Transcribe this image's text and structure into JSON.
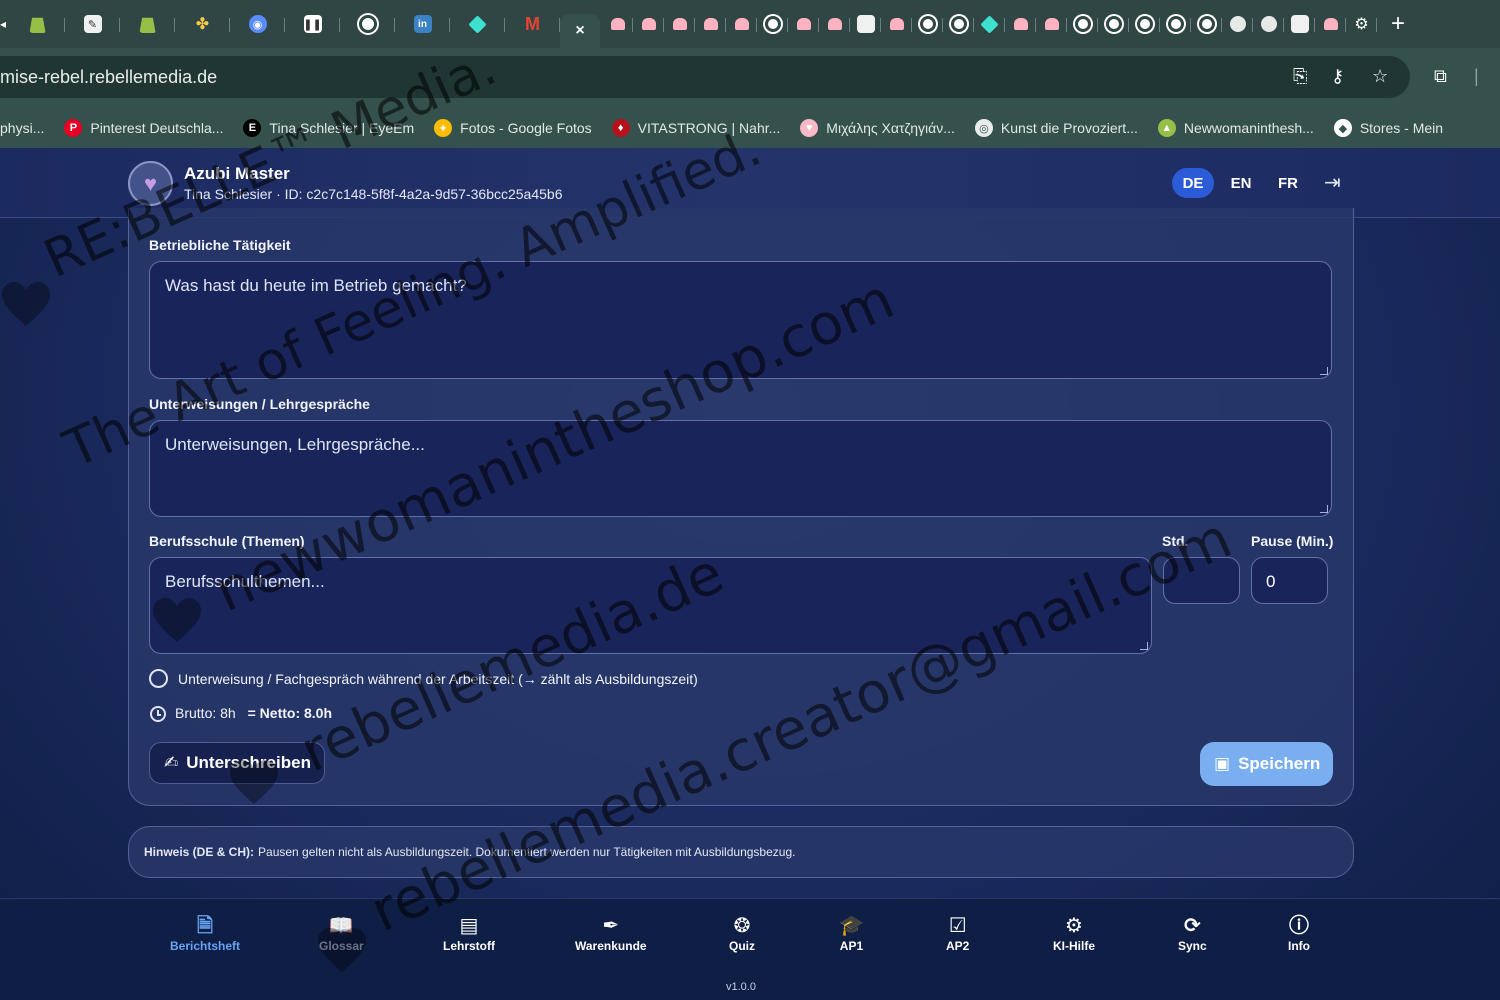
{
  "browser": {
    "tabs": [
      {
        "icon": "shopify-icon"
      },
      {
        "icon": "app-icon"
      },
      {
        "icon": "shopify-icon"
      },
      {
        "icon": "pinwheel-icon"
      },
      {
        "icon": "circle-app-icon"
      },
      {
        "icon": "notion-icon"
      },
      {
        "icon": "github-icon"
      },
      {
        "icon": "linkedin-icon"
      },
      {
        "icon": "diamond-icon"
      },
      {
        "icon": "gmail-icon"
      }
    ],
    "active_tab": {
      "close_glyph": "×"
    },
    "small_tabs_count": 25,
    "new_tab_glyph": "+",
    "url": "mise-rebel.rebellemedia.de",
    "bookmarks": [
      {
        "label": "physi...",
        "icon_color": "#34514d"
      },
      {
        "label": "Pinterest Deutschla...",
        "icon_color": "#e60023",
        "icon_glyph": "P"
      },
      {
        "label": "Tina Schlesier | EyeEm",
        "icon_color": "#000000",
        "icon_glyph": "E"
      },
      {
        "label": "Fotos - Google Fotos",
        "icon_color": "#fbbc04",
        "icon_glyph": "✦"
      },
      {
        "label": "VITASTRONG | Nahr...",
        "icon_color": "#b5121b",
        "icon_glyph": "♦"
      },
      {
        "label": "Μιχάλης Χατζηγιάν...",
        "icon_color": "#f7b8c8",
        "icon_glyph": "♥"
      },
      {
        "label": "Kunst die Provoziert...",
        "icon_color": "#e9ecec",
        "icon_glyph": "◎"
      },
      {
        "label": "Newwomaninthesh...",
        "icon_color": "#95bf47",
        "icon_glyph": "▲"
      },
      {
        "label": "Stores - Mein",
        "icon_color": "#ffffff",
        "icon_glyph": "◆"
      }
    ]
  },
  "app": {
    "title": "Azubi Master",
    "subtitle": "Tina Schlesier · ID: c2c7c148-5f8f-4a2a-9d57-36bcc25a45b6",
    "languages": [
      {
        "code": "DE",
        "active": true
      },
      {
        "code": "EN",
        "active": false
      },
      {
        "code": "FR",
        "active": false
      }
    ]
  },
  "form": {
    "activity": {
      "label": "Betriebliche Tätigkeit",
      "placeholder": "Was hast du heute im Betrieb gemacht?"
    },
    "instructions": {
      "label": "Unterweisungen / Lehrgespräche",
      "placeholder": "Unterweisungen, Lehrgespräche..."
    },
    "school": {
      "label": "Berufsschule (Themen)",
      "placeholder": "Berufsschulthemen..."
    },
    "hours": {
      "label": "Std.",
      "value": ""
    },
    "pause": {
      "label": "Pause (Min.)",
      "value": "0"
    },
    "checkbox_label": "Unterweisung / Fachgespräch während der Arbeitszeit (→ zählt als Ausbildungszeit)",
    "gross": "Brutto: 8h",
    "net_prefix": "=",
    "net": "Netto: 8.0h",
    "sign_label": "Unterschreiben",
    "save_label": "Speichern"
  },
  "hint": {
    "title": "Hinweis (DE & CH):",
    "text": "Pausen gelten nicht als Ausbildungszeit. Dokumentiert werden nur Tätigkeiten mit Ausbildungsbezug."
  },
  "nav": [
    {
      "label": "Berichtsheft",
      "icon": "document-icon",
      "state": "active"
    },
    {
      "label": "Glossar",
      "icon": "book-icon",
      "state": "muted"
    },
    {
      "label": "Lehrstoff",
      "icon": "notebook-icon",
      "state": "normal"
    },
    {
      "label": "Warenkunde",
      "icon": "pen-tool-icon",
      "state": "normal"
    },
    {
      "label": "Quiz",
      "icon": "brain-icon",
      "state": "normal"
    },
    {
      "label": "AP1",
      "icon": "graduation-cap-icon",
      "state": "normal"
    },
    {
      "label": "AP2",
      "icon": "clipboard-check-icon",
      "state": "normal"
    },
    {
      "label": "KI-Hilfe",
      "icon": "robot-icon",
      "state": "normal"
    },
    {
      "label": "Sync",
      "icon": "refresh-icon",
      "state": "normal"
    },
    {
      "label": "Info",
      "icon": "info-icon",
      "state": "normal"
    }
  ],
  "version": "v1.0.0",
  "watermark": [
    "RE:BELLE™ Media.",
    "The Art of Feeling. Amplified.",
    "newwomanintheshop.com",
    "rebellemedia.de",
    "rebellemedia.creator@gmail.com"
  ]
}
